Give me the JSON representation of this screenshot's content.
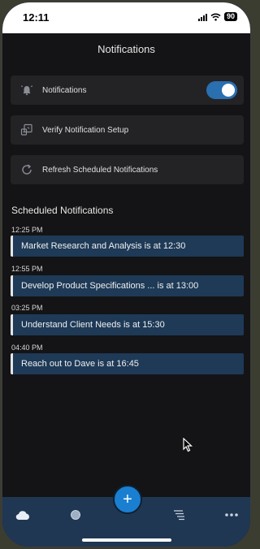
{
  "status_bar": {
    "time": "12:11",
    "battery": "90"
  },
  "header": {
    "title": "Notifications"
  },
  "settings": {
    "notifications_label": "Notifications",
    "notifications_enabled": true,
    "verify_label": "Verify Notification Setup",
    "refresh_label": "Refresh Scheduled Notifications"
  },
  "scheduled": {
    "title": "Scheduled Notifications",
    "items": [
      {
        "time": "12:25 PM",
        "text": "Market Research and Analysis is at 12:30"
      },
      {
        "time": "12:55 PM",
        "text": "Develop Product Specifications ... is at 13:00"
      },
      {
        "time": "03:25 PM",
        "text": "Understand Client Needs is at 15:30"
      },
      {
        "time": "04:40 PM",
        "text": "Reach out to Dave is at 16:45"
      }
    ]
  },
  "tabbar": {
    "fab_label": "+",
    "icons": [
      "cloud-icon",
      "circle-icon",
      "list-icon",
      "more-icon"
    ]
  },
  "colors": {
    "background": "#141416",
    "card": "#1e3a57",
    "accent": "#1a7fd0",
    "tabbar": "#1f3752"
  }
}
